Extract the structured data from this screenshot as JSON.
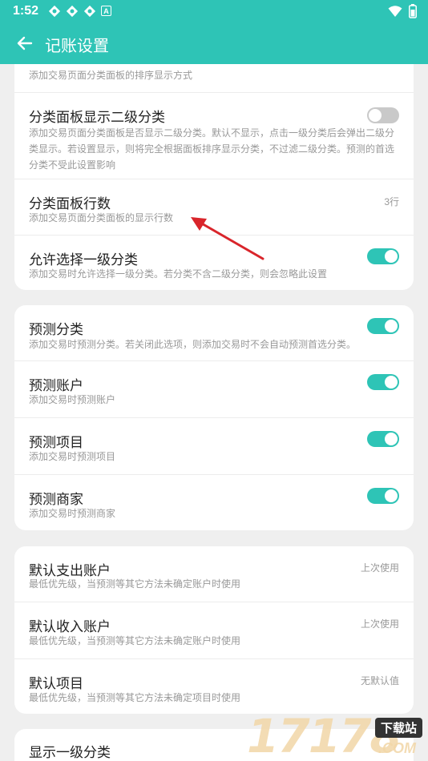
{
  "status": {
    "time": "1:52",
    "notification_badge": "A"
  },
  "appbar": {
    "title": "记账设置"
  },
  "card1": {
    "top_desc": "添加交易页面分类面板的排序显示方式",
    "rows": [
      {
        "title": "分类面板显示二级分类",
        "desc": "添加交易页面分类面板是否显示二级分类。默认不显示，点击一级分类后会弹出二级分类显示。若设置显示，则将完全根据面板排序显示分类，不过滤二级分类。预测的首选分类不受此设置影响",
        "toggle": "off"
      },
      {
        "title": "分类面板行数",
        "desc": "添加交易页面分类面板的显示行数",
        "value": "3行"
      },
      {
        "title": "允许选择一级分类",
        "desc": "添加交易时允许选择一级分类。若分类不含二级分类，则会忽略此设置",
        "toggle": "on"
      }
    ]
  },
  "card2": {
    "rows": [
      {
        "title": "预测分类",
        "desc": "添加交易时预测分类。若关闭此选项，则添加交易时不会自动预测首选分类。",
        "toggle": "on"
      },
      {
        "title": "预测账户",
        "desc": "添加交易时预测账户",
        "toggle": "on"
      },
      {
        "title": "预测项目",
        "desc": "添加交易时预测项目",
        "toggle": "on"
      },
      {
        "title": "预测商家",
        "desc": "添加交易时预测商家",
        "toggle": "on"
      }
    ]
  },
  "card3": {
    "rows": [
      {
        "title": "默认支出账户",
        "desc": "最低优先级，当预测等其它方法未确定账户时使用",
        "value": "上次使用"
      },
      {
        "title": "默认收入账户",
        "desc": "最低优先级，当预测等其它方法未确定账户时使用",
        "value": "上次使用"
      },
      {
        "title": "默认项目",
        "desc": "最低优先级，当预测等其它方法未确定项目时使用",
        "value": "无默认值"
      }
    ]
  },
  "card4": {
    "rows": [
      {
        "title": "显示一级分类"
      }
    ]
  },
  "watermark": {
    "number": "17178",
    "badge": "下载站",
    "domain": ".COM"
  },
  "colors": {
    "accent": "#2ec4b6",
    "background": "#efefef",
    "arrow": "#d9252b"
  },
  "icons": {
    "back": "arrow-left-icon",
    "wifi": "wifi-icon",
    "battery": "battery-icon",
    "annotation": "red-arrow-annotation"
  }
}
